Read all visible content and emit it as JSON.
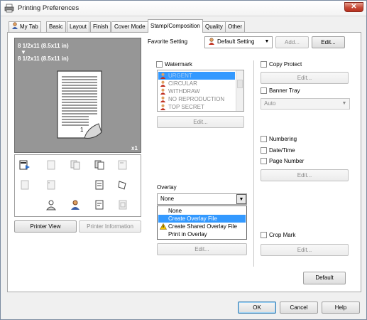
{
  "window": {
    "title": "Printing Preferences"
  },
  "tabs": [
    {
      "label": "My Tab"
    },
    {
      "label": "Basic"
    },
    {
      "label": "Layout"
    },
    {
      "label": "Finish"
    },
    {
      "label": "Cover Mode"
    },
    {
      "label": "Stamp/Composition",
      "active": true
    },
    {
      "label": "Quality"
    },
    {
      "label": "Other"
    }
  ],
  "preview": {
    "paper_line1": "8 1/2x11 (8.5x11 in)",
    "arrow": "▼",
    "paper_line2": "8 1/2x11 (8.5x11 in)",
    "copies": "x1",
    "page_number": "1"
  },
  "buttons_left": {
    "printer_view": "Printer View",
    "printer_information": "Printer Information"
  },
  "favorite": {
    "label": "Favorite Setting",
    "value": "Default Setting",
    "add_label": "Add...",
    "edit_label": "Edit..."
  },
  "watermark": {
    "label": "Watermark",
    "items": [
      "URGENT",
      "CIRCULAR",
      "WITHDRAW",
      "NO REPRODUCTION",
      "TOP SECRET"
    ],
    "selected_index": 0,
    "edit_label": "Edit..."
  },
  "overlay": {
    "label": "Overlay",
    "value": "None",
    "options": [
      "None",
      "Create Overlay File",
      "Create Shared Overlay File",
      "Print in Overlay"
    ],
    "highlighted_index": 1,
    "edit_label": "Edit..."
  },
  "copy_protect": {
    "label": "Copy Protect",
    "edit_label": "Edit..."
  },
  "banner_tray": {
    "label": "Banner Tray",
    "value": "Auto"
  },
  "numbering": {
    "numbering_label": "Numbering",
    "datetime_label": "Date/Time",
    "page_number_label": "Page Number",
    "edit_label": "Edit..."
  },
  "crop_mark": {
    "label": "Crop Mark",
    "edit_label": "Edit..."
  },
  "default_button": "Default",
  "footer": {
    "ok": "OK",
    "cancel": "Cancel",
    "help": "Help"
  },
  "colors": {
    "selection": "#3399ff",
    "preview_bg": "#969696",
    "close_red": "#c64b38"
  }
}
